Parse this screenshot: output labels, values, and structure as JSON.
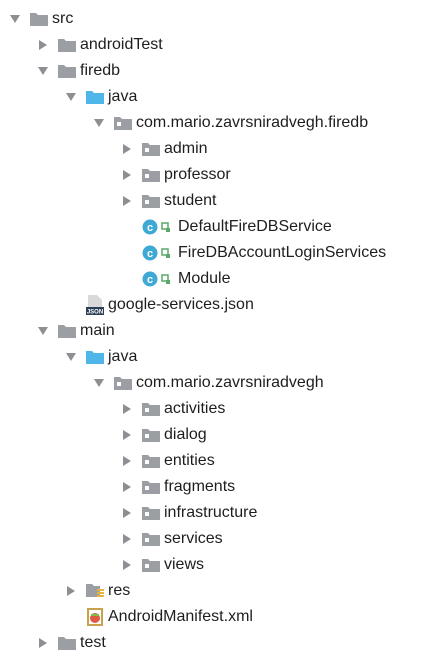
{
  "colors": {
    "folder_gray": "#9b9ea3",
    "folder_blue": "#4fb6e9",
    "class_badge": "#3fa9d6",
    "visibility_green": "#59a869",
    "arrow": "#8e8e93"
  },
  "tree": [
    {
      "depth": 0,
      "state": "expanded",
      "icon": "folder-gray-icon",
      "label": "src"
    },
    {
      "depth": 1,
      "state": "collapsed",
      "icon": "folder-gray-icon",
      "label": "androidTest"
    },
    {
      "depth": 1,
      "state": "expanded",
      "icon": "folder-gray-icon",
      "label": "firedb"
    },
    {
      "depth": 2,
      "state": "expanded",
      "icon": "folder-blue-icon",
      "label": "java"
    },
    {
      "depth": 3,
      "state": "expanded",
      "icon": "package-icon",
      "label": "com.mario.zavrsniradvegh.firedb"
    },
    {
      "depth": 4,
      "state": "collapsed",
      "icon": "package-icon",
      "label": "admin"
    },
    {
      "depth": 4,
      "state": "collapsed",
      "icon": "package-icon",
      "label": "professor"
    },
    {
      "depth": 4,
      "state": "collapsed",
      "icon": "package-icon",
      "label": "student"
    },
    {
      "depth": 4,
      "state": "leaf",
      "icon": "class-icon",
      "label": "DefaultFireDBService"
    },
    {
      "depth": 4,
      "state": "leaf",
      "icon": "class-icon",
      "label": "FireDBAccountLoginServices"
    },
    {
      "depth": 4,
      "state": "leaf",
      "icon": "class-icon",
      "label": "Module"
    },
    {
      "depth": 2,
      "state": "leaf",
      "icon": "json-file-icon",
      "label": "google-services.json"
    },
    {
      "depth": 1,
      "state": "expanded",
      "icon": "folder-gray-icon",
      "label": "main"
    },
    {
      "depth": 2,
      "state": "expanded",
      "icon": "folder-blue-icon",
      "label": "java"
    },
    {
      "depth": 3,
      "state": "expanded",
      "icon": "package-icon",
      "label": "com.mario.zavrsniradvegh"
    },
    {
      "depth": 4,
      "state": "collapsed",
      "icon": "package-icon",
      "label": "activities"
    },
    {
      "depth": 4,
      "state": "collapsed",
      "icon": "package-icon",
      "label": "dialog"
    },
    {
      "depth": 4,
      "state": "collapsed",
      "icon": "package-icon",
      "label": "entities"
    },
    {
      "depth": 4,
      "state": "collapsed",
      "icon": "package-icon",
      "label": "fragments"
    },
    {
      "depth": 4,
      "state": "collapsed",
      "icon": "package-icon",
      "label": "infrastructure"
    },
    {
      "depth": 4,
      "state": "collapsed",
      "icon": "package-icon",
      "label": "services"
    },
    {
      "depth": 4,
      "state": "collapsed",
      "icon": "package-icon",
      "label": "views"
    },
    {
      "depth": 2,
      "state": "collapsed",
      "icon": "res-folder-icon",
      "label": "res"
    },
    {
      "depth": 2,
      "state": "leaf",
      "icon": "manifest-file-icon",
      "label": "AndroidManifest.xml"
    },
    {
      "depth": 1,
      "state": "collapsed",
      "icon": "folder-gray-icon",
      "label": "test"
    }
  ]
}
